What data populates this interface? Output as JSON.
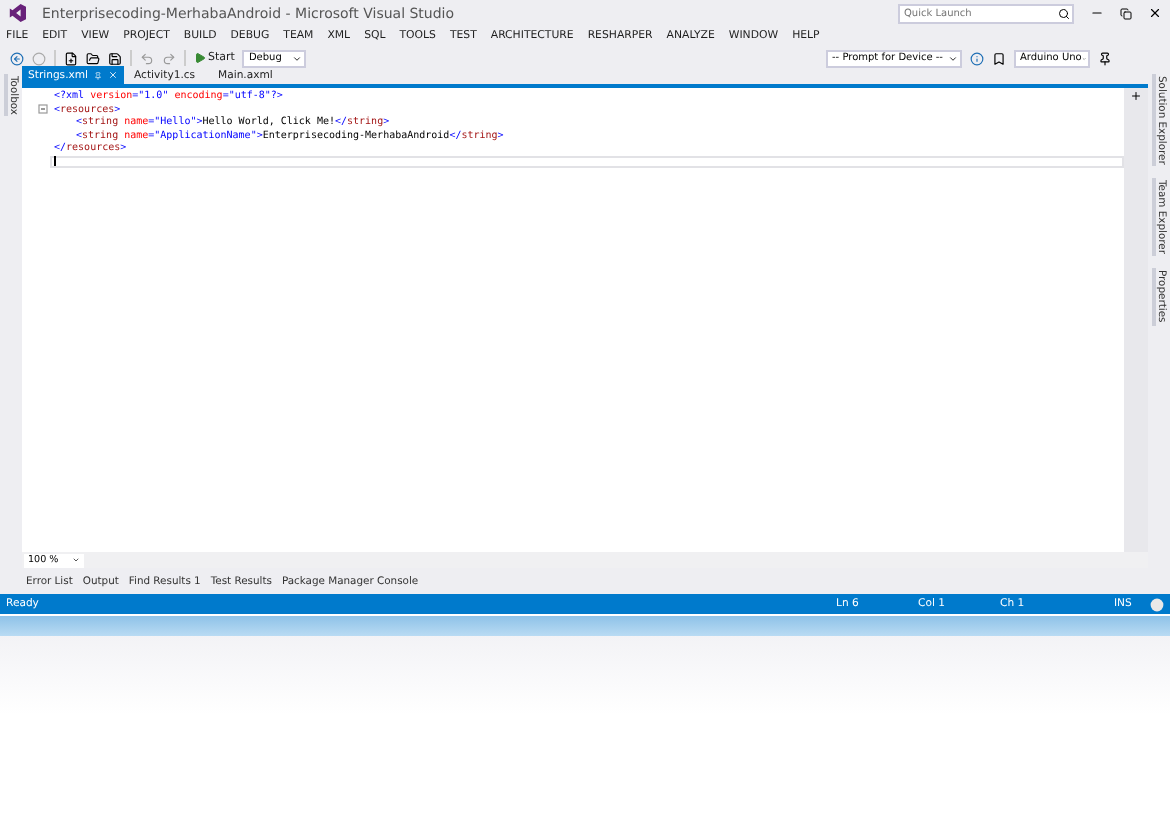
{
  "window": {
    "title": "Enterprisecoding-MerhabaAndroid - Microsoft Visual Studio"
  },
  "quick_launch": {
    "placeholder": "Quick Launch"
  },
  "menu": [
    "FILE",
    "EDIT",
    "VIEW",
    "PROJECT",
    "BUILD",
    "DEBUG",
    "TEAM",
    "XML",
    "SQL",
    "TOOLS",
    "TEST",
    "ARCHITECTURE",
    "RESHARPER",
    "ANALYZE",
    "WINDOW",
    "HELP"
  ],
  "toolbar": {
    "start": "Start",
    "configuration": "Debug",
    "device": "-- Prompt for Device --",
    "board": "Arduino Uno"
  },
  "left_panels": [
    "Toolbox"
  ],
  "right_panels": [
    "Solution Explorer",
    "Team Explorer",
    "Properties"
  ],
  "tabs": [
    {
      "label": "Strings.xml",
      "selected": true
    },
    {
      "label": "Activity1.cs",
      "selected": false
    },
    {
      "label": "Main.axml",
      "selected": false
    }
  ],
  "editor": {
    "lines": [
      {
        "tokens": [
          {
            "kind": "tag",
            "text": "<?xml "
          },
          {
            "kind": "attr",
            "text": "version"
          },
          {
            "kind": "tag",
            "text": "="
          },
          {
            "kind": "value",
            "text": "\"1.0\""
          },
          {
            "kind": "attr",
            "text": " encoding"
          },
          {
            "kind": "tag",
            "text": "="
          },
          {
            "kind": "value",
            "text": "\"utf-8\""
          },
          {
            "kind": "tag",
            "text": "?>"
          }
        ],
        "collapsible": false,
        "indent": false,
        "current": false
      },
      {
        "tokens": [
          {
            "kind": "tag",
            "text": "<"
          },
          {
            "kind": "name",
            "text": "resources"
          },
          {
            "kind": "tag",
            "text": ">"
          }
        ],
        "collapsible": true,
        "indent": false,
        "current": false
      },
      {
        "tokens": [
          {
            "kind": "tag",
            "text": "<"
          },
          {
            "kind": "name",
            "text": "string"
          },
          {
            "kind": "attr",
            "text": " name"
          },
          {
            "kind": "tag",
            "text": "="
          },
          {
            "kind": "value",
            "text": "\"Hello\""
          },
          {
            "kind": "tag",
            "text": ">"
          },
          {
            "kind": "text",
            "text": "Hello World, Click Me!"
          },
          {
            "kind": "tag",
            "text": "</"
          },
          {
            "kind": "name",
            "text": "string"
          },
          {
            "kind": "tag",
            "text": ">"
          }
        ],
        "collapsible": false,
        "indent": true,
        "current": false
      },
      {
        "tokens": [
          {
            "kind": "tag",
            "text": "<"
          },
          {
            "kind": "name",
            "text": "string"
          },
          {
            "kind": "attr",
            "text": " name"
          },
          {
            "kind": "tag",
            "text": "="
          },
          {
            "kind": "value",
            "text": "\"ApplicationName\""
          },
          {
            "kind": "tag",
            "text": ">"
          },
          {
            "kind": "text",
            "text": "Enterprisecoding-MerhabaAndroid"
          },
          {
            "kind": "tag",
            "text": "</"
          },
          {
            "kind": "name",
            "text": "string"
          },
          {
            "kind": "tag",
            "text": ">"
          }
        ],
        "collapsible": false,
        "indent": true,
        "current": false
      },
      {
        "tokens": [
          {
            "kind": "tag",
            "text": "</"
          },
          {
            "kind": "name",
            "text": "resources"
          },
          {
            "kind": "tag",
            "text": ">"
          }
        ],
        "collapsible": false,
        "indent": false,
        "current": false
      },
      {
        "collapsible": false,
        "indent": false,
        "current": true
      }
    ]
  },
  "zoom": "100 %",
  "bottom_tabs": [
    "Error List",
    "Output",
    "Find Results 1",
    "Test Results",
    "Package Manager Console"
  ],
  "status_bar": {
    "message": "Ready",
    "line": "Ln 6",
    "column": "Col 1",
    "char": "Ch 1",
    "mode": "INS"
  }
}
